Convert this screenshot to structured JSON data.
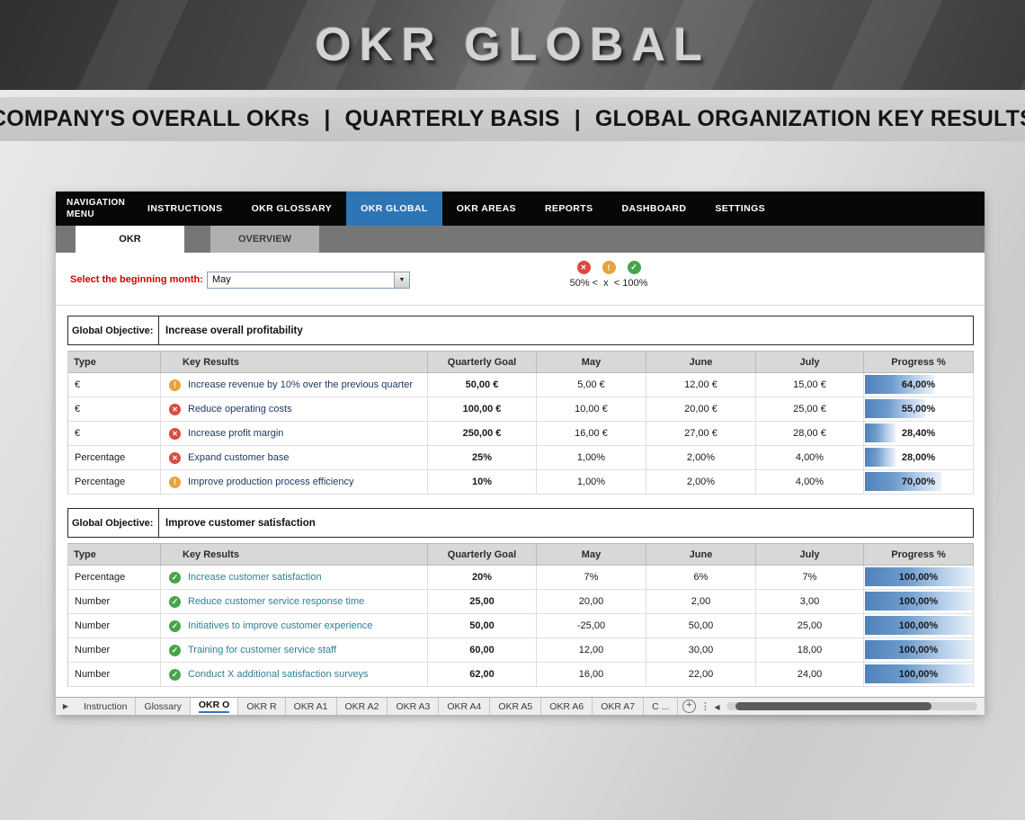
{
  "header": {
    "title": "OKR GLOBAL"
  },
  "banner": {
    "parts": [
      "COMPANY'S OVERALL OKRs",
      "QUARTERLY BASIS",
      "GLOBAL ORGANIZATION  KEY RESULTS"
    ],
    "separator": "|"
  },
  "nav": {
    "items": [
      {
        "label": "NAVIGATION MENU",
        "active": false
      },
      {
        "label": "INSTRUCTIONS",
        "active": false
      },
      {
        "label": "OKR GLOSSARY",
        "active": false
      },
      {
        "label": "OKR GLOBAL",
        "active": true
      },
      {
        "label": "OKR AREAS",
        "active": false
      },
      {
        "label": "REPORTS",
        "active": false
      },
      {
        "label": "DASHBOARD",
        "active": false
      },
      {
        "label": "SETTINGS",
        "active": false
      }
    ]
  },
  "view_tabs": {
    "okr": "OKR",
    "overview": "OVERVIEW"
  },
  "controls": {
    "month_label": "Select the beginning month:",
    "month_value": "May",
    "legend_text": "50% <  x  < 100%",
    "legend_icons": [
      "error-icon",
      "warning-icon",
      "success-icon"
    ]
  },
  "tables": [
    {
      "objective_label": "Global Objective:",
      "objective": "Increase overall profitability",
      "headers": [
        "Type",
        "Key Results",
        "Quarterly Goal",
        "May",
        "June",
        "July",
        "Progress %"
      ],
      "rows": [
        {
          "type": "€",
          "status": "warning",
          "key_result": "Increase revenue by 10% over the previous quarter",
          "goal": "50,00 €",
          "may": "5,00 €",
          "june": "12,00 €",
          "july": "15,00 €",
          "progress_label": "64,00%",
          "progress": 64
        },
        {
          "type": "€",
          "status": "error",
          "key_result": "Reduce operating costs",
          "goal": "100,00 €",
          "may": "10,00 €",
          "june": "20,00 €",
          "july": "25,00 €",
          "progress_label": "55,00%",
          "progress": 55
        },
        {
          "type": "€",
          "status": "error",
          "key_result": "Increase profit margin",
          "goal": "250,00 €",
          "may": "16,00 €",
          "june": "27,00 €",
          "july": "28,00 €",
          "progress_label": "28,40%",
          "progress": 28.4
        },
        {
          "type": "Percentage",
          "status": "error",
          "key_result": "Expand customer base",
          "goal": "25%",
          "may": "1,00%",
          "june": "2,00%",
          "july": "4,00%",
          "progress_label": "28,00%",
          "progress": 28
        },
        {
          "type": "Percentage",
          "status": "warning",
          "key_result": "Improve production process efficiency",
          "goal": "10%",
          "may": "1,00%",
          "june": "2,00%",
          "july": "4,00%",
          "progress_label": "70,00%",
          "progress": 70
        }
      ]
    },
    {
      "objective_label": "Global Objective:",
      "objective": "Improve customer satisfaction",
      "headers": [
        "Type",
        "Key Results",
        "Quarterly Goal",
        "May",
        "June",
        "July",
        "Progress %"
      ],
      "rows": [
        {
          "type": "Percentage",
          "status": "ok",
          "key_result": "Increase customer satisfaction",
          "goal": "20%",
          "may": "7%",
          "june": "6%",
          "july": "7%",
          "progress_label": "100,00%",
          "progress": 100
        },
        {
          "type": "Number",
          "status": "ok",
          "key_result": "Reduce customer service response time",
          "goal": "25,00",
          "may": "20,00",
          "june": "2,00",
          "july": "3,00",
          "progress_label": "100,00%",
          "progress": 100
        },
        {
          "type": "Number",
          "status": "ok",
          "key_result": "Initiatives to improve customer experience",
          "goal": "50,00",
          "may": "-25,00",
          "june": "50,00",
          "july": "25,00",
          "progress_label": "100,00%",
          "progress": 100
        },
        {
          "type": "Number",
          "status": "ok",
          "key_result": "Training for customer service staff",
          "goal": "60,00",
          "may": "12,00",
          "june": "30,00",
          "july": "18,00",
          "progress_label": "100,00%",
          "progress": 100
        },
        {
          "type": "Number",
          "status": "ok",
          "key_result": "Conduct X additional satisfaction surveys",
          "goal": "62,00",
          "may": "16,00",
          "june": "22,00",
          "july": "24,00",
          "progress_label": "100,00%",
          "progress": 100
        }
      ]
    }
  ],
  "sheet_tabs": [
    "Instruction",
    "Glossary",
    "OKR O",
    "OKR R",
    "OKR A1",
    "OKR A2",
    "OKR A3",
    "OKR A4",
    "OKR A5",
    "OKR A6",
    "OKR A7",
    "C ..."
  ]
}
